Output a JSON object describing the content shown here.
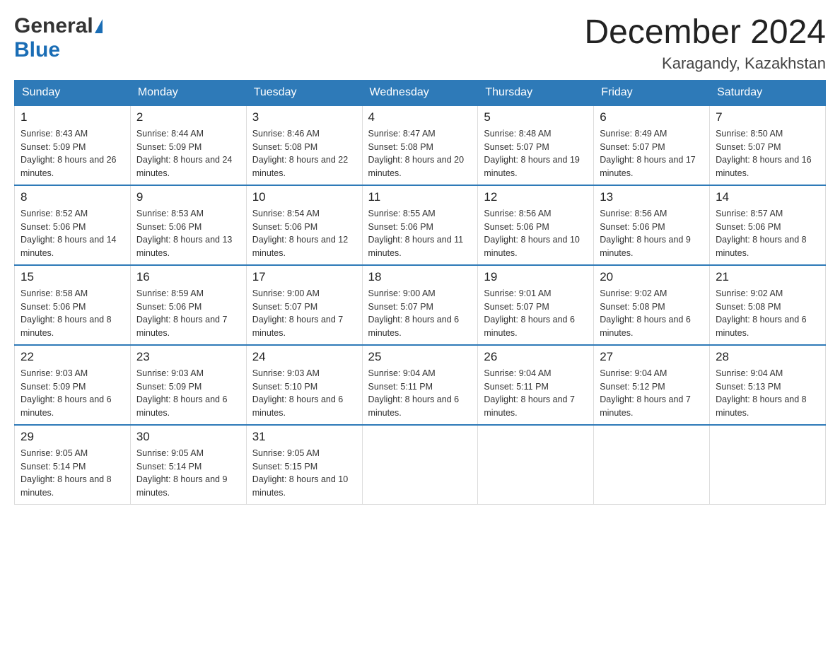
{
  "header": {
    "title": "December 2024",
    "subtitle": "Karagandy, Kazakhstan"
  },
  "logo": {
    "general": "General",
    "blue": "Blue"
  },
  "days": [
    "Sunday",
    "Monday",
    "Tuesday",
    "Wednesday",
    "Thursday",
    "Friday",
    "Saturday"
  ],
  "weeks": [
    [
      {
        "num": "1",
        "sunrise": "8:43 AM",
        "sunset": "5:09 PM",
        "daylight": "8 hours and 26 minutes."
      },
      {
        "num": "2",
        "sunrise": "8:44 AM",
        "sunset": "5:09 PM",
        "daylight": "8 hours and 24 minutes."
      },
      {
        "num": "3",
        "sunrise": "8:46 AM",
        "sunset": "5:08 PM",
        "daylight": "8 hours and 22 minutes."
      },
      {
        "num": "4",
        "sunrise": "8:47 AM",
        "sunset": "5:08 PM",
        "daylight": "8 hours and 20 minutes."
      },
      {
        "num": "5",
        "sunrise": "8:48 AM",
        "sunset": "5:07 PM",
        "daylight": "8 hours and 19 minutes."
      },
      {
        "num": "6",
        "sunrise": "8:49 AM",
        "sunset": "5:07 PM",
        "daylight": "8 hours and 17 minutes."
      },
      {
        "num": "7",
        "sunrise": "8:50 AM",
        "sunset": "5:07 PM",
        "daylight": "8 hours and 16 minutes."
      }
    ],
    [
      {
        "num": "8",
        "sunrise": "8:52 AM",
        "sunset": "5:06 PM",
        "daylight": "8 hours and 14 minutes."
      },
      {
        "num": "9",
        "sunrise": "8:53 AM",
        "sunset": "5:06 PM",
        "daylight": "8 hours and 13 minutes."
      },
      {
        "num": "10",
        "sunrise": "8:54 AM",
        "sunset": "5:06 PM",
        "daylight": "8 hours and 12 minutes."
      },
      {
        "num": "11",
        "sunrise": "8:55 AM",
        "sunset": "5:06 PM",
        "daylight": "8 hours and 11 minutes."
      },
      {
        "num": "12",
        "sunrise": "8:56 AM",
        "sunset": "5:06 PM",
        "daylight": "8 hours and 10 minutes."
      },
      {
        "num": "13",
        "sunrise": "8:56 AM",
        "sunset": "5:06 PM",
        "daylight": "8 hours and 9 minutes."
      },
      {
        "num": "14",
        "sunrise": "8:57 AM",
        "sunset": "5:06 PM",
        "daylight": "8 hours and 8 minutes."
      }
    ],
    [
      {
        "num": "15",
        "sunrise": "8:58 AM",
        "sunset": "5:06 PM",
        "daylight": "8 hours and 8 minutes."
      },
      {
        "num": "16",
        "sunrise": "8:59 AM",
        "sunset": "5:06 PM",
        "daylight": "8 hours and 7 minutes."
      },
      {
        "num": "17",
        "sunrise": "9:00 AM",
        "sunset": "5:07 PM",
        "daylight": "8 hours and 7 minutes."
      },
      {
        "num": "18",
        "sunrise": "9:00 AM",
        "sunset": "5:07 PM",
        "daylight": "8 hours and 6 minutes."
      },
      {
        "num": "19",
        "sunrise": "9:01 AM",
        "sunset": "5:07 PM",
        "daylight": "8 hours and 6 minutes."
      },
      {
        "num": "20",
        "sunrise": "9:02 AM",
        "sunset": "5:08 PM",
        "daylight": "8 hours and 6 minutes."
      },
      {
        "num": "21",
        "sunrise": "9:02 AM",
        "sunset": "5:08 PM",
        "daylight": "8 hours and 6 minutes."
      }
    ],
    [
      {
        "num": "22",
        "sunrise": "9:03 AM",
        "sunset": "5:09 PM",
        "daylight": "8 hours and 6 minutes."
      },
      {
        "num": "23",
        "sunrise": "9:03 AM",
        "sunset": "5:09 PM",
        "daylight": "8 hours and 6 minutes."
      },
      {
        "num": "24",
        "sunrise": "9:03 AM",
        "sunset": "5:10 PM",
        "daylight": "8 hours and 6 minutes."
      },
      {
        "num": "25",
        "sunrise": "9:04 AM",
        "sunset": "5:11 PM",
        "daylight": "8 hours and 6 minutes."
      },
      {
        "num": "26",
        "sunrise": "9:04 AM",
        "sunset": "5:11 PM",
        "daylight": "8 hours and 7 minutes."
      },
      {
        "num": "27",
        "sunrise": "9:04 AM",
        "sunset": "5:12 PM",
        "daylight": "8 hours and 7 minutes."
      },
      {
        "num": "28",
        "sunrise": "9:04 AM",
        "sunset": "5:13 PM",
        "daylight": "8 hours and 8 minutes."
      }
    ],
    [
      {
        "num": "29",
        "sunrise": "9:05 AM",
        "sunset": "5:14 PM",
        "daylight": "8 hours and 8 minutes."
      },
      {
        "num": "30",
        "sunrise": "9:05 AM",
        "sunset": "5:14 PM",
        "daylight": "8 hours and 9 minutes."
      },
      {
        "num": "31",
        "sunrise": "9:05 AM",
        "sunset": "5:15 PM",
        "daylight": "8 hours and 10 minutes."
      },
      null,
      null,
      null,
      null
    ]
  ]
}
